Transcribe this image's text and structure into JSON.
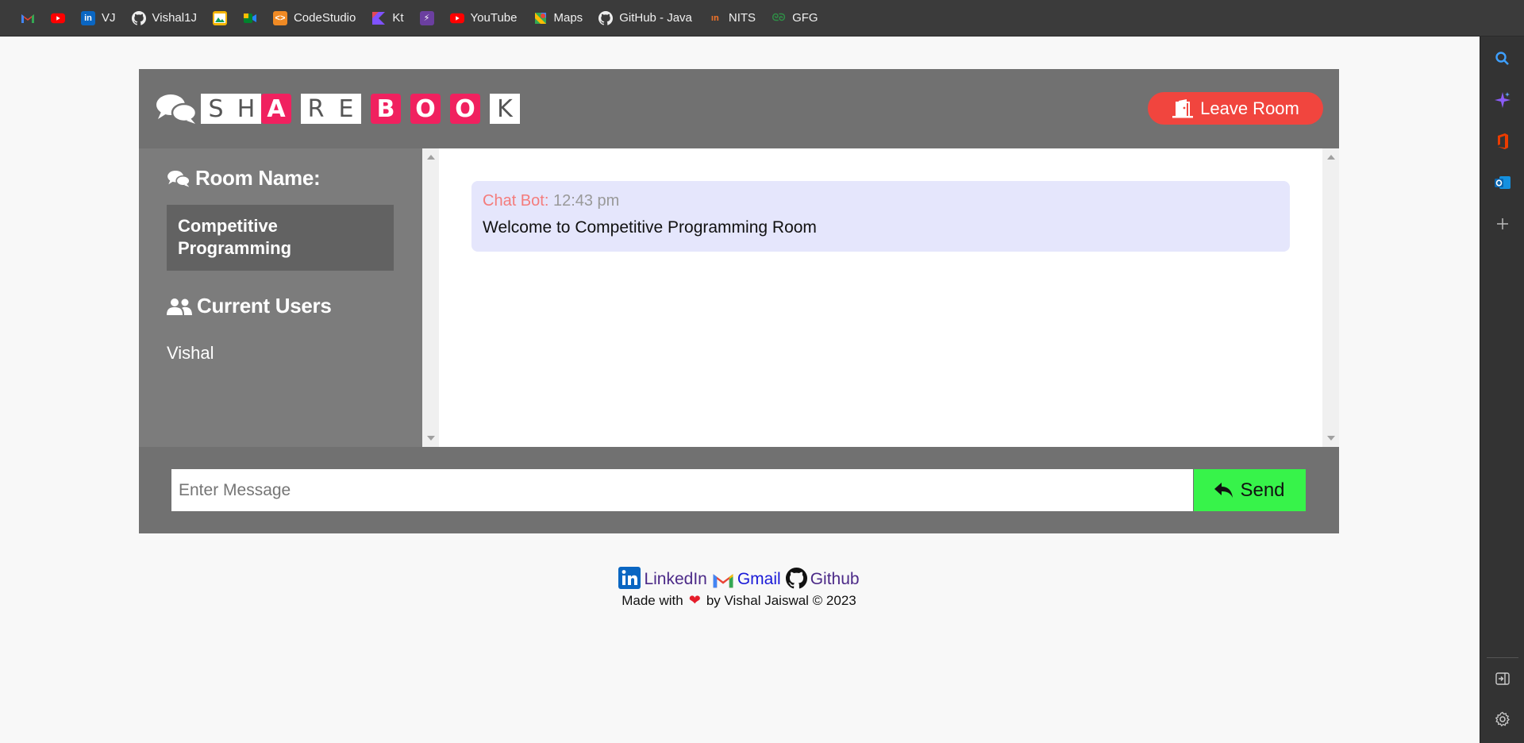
{
  "bookmarks": [
    {
      "icon": "gmail-icon",
      "label": ""
    },
    {
      "icon": "youtube-icon",
      "label": ""
    },
    {
      "icon": "linkedin-icon",
      "label": "VJ"
    },
    {
      "icon": "github-icon",
      "label": "Vishal1J"
    },
    {
      "icon": "photos-icon",
      "label": ""
    },
    {
      "icon": "meet-icon",
      "label": ""
    },
    {
      "icon": "codestudio-icon",
      "label": "CodeStudio"
    },
    {
      "icon": "kotlin-icon",
      "label": "Kt"
    },
    {
      "icon": "bolt-icon",
      "label": ""
    },
    {
      "icon": "youtube-icon",
      "label": "YouTube"
    },
    {
      "icon": "maps-icon",
      "label": "Maps"
    },
    {
      "icon": "github-icon",
      "label": "GitHub - Java"
    },
    {
      "icon": "nits-icon",
      "label": "NITS"
    },
    {
      "icon": "gfg-icon",
      "label": "GFG"
    }
  ],
  "header": {
    "logo_letters": [
      "S",
      "H",
      "A",
      "R",
      "E",
      "B",
      "O",
      "O",
      "K"
    ],
    "leave_label": "Leave Room"
  },
  "sidebar": {
    "room_heading": "Room Name:",
    "room_name": "Competitive Programming",
    "users_heading": "Current Users",
    "users": [
      "Vishal"
    ]
  },
  "messages": [
    {
      "from": "Chat Bot:",
      "time": "12:43 pm",
      "text": "Welcome to Competitive Programming Room"
    }
  ],
  "composer": {
    "placeholder": "Enter Message",
    "send_label": "Send"
  },
  "footer": {
    "links": [
      {
        "icon": "linkedin-icon",
        "label": "LinkedIn"
      },
      {
        "icon": "gmail-icon",
        "label": "Gmail"
      },
      {
        "icon": "github-icon",
        "label": "Github"
      }
    ],
    "made_prefix": "Made with",
    "made_suffix": "by Vishal Jaiswal © 2023"
  },
  "colors": {
    "header_bg": "#717171",
    "sidebar_bg": "#7c7c7c",
    "leave_btn": "#f1453e",
    "send_btn": "#37f34a",
    "logo_accent": "#f0215f",
    "message_bg": "#e5e6fc"
  }
}
